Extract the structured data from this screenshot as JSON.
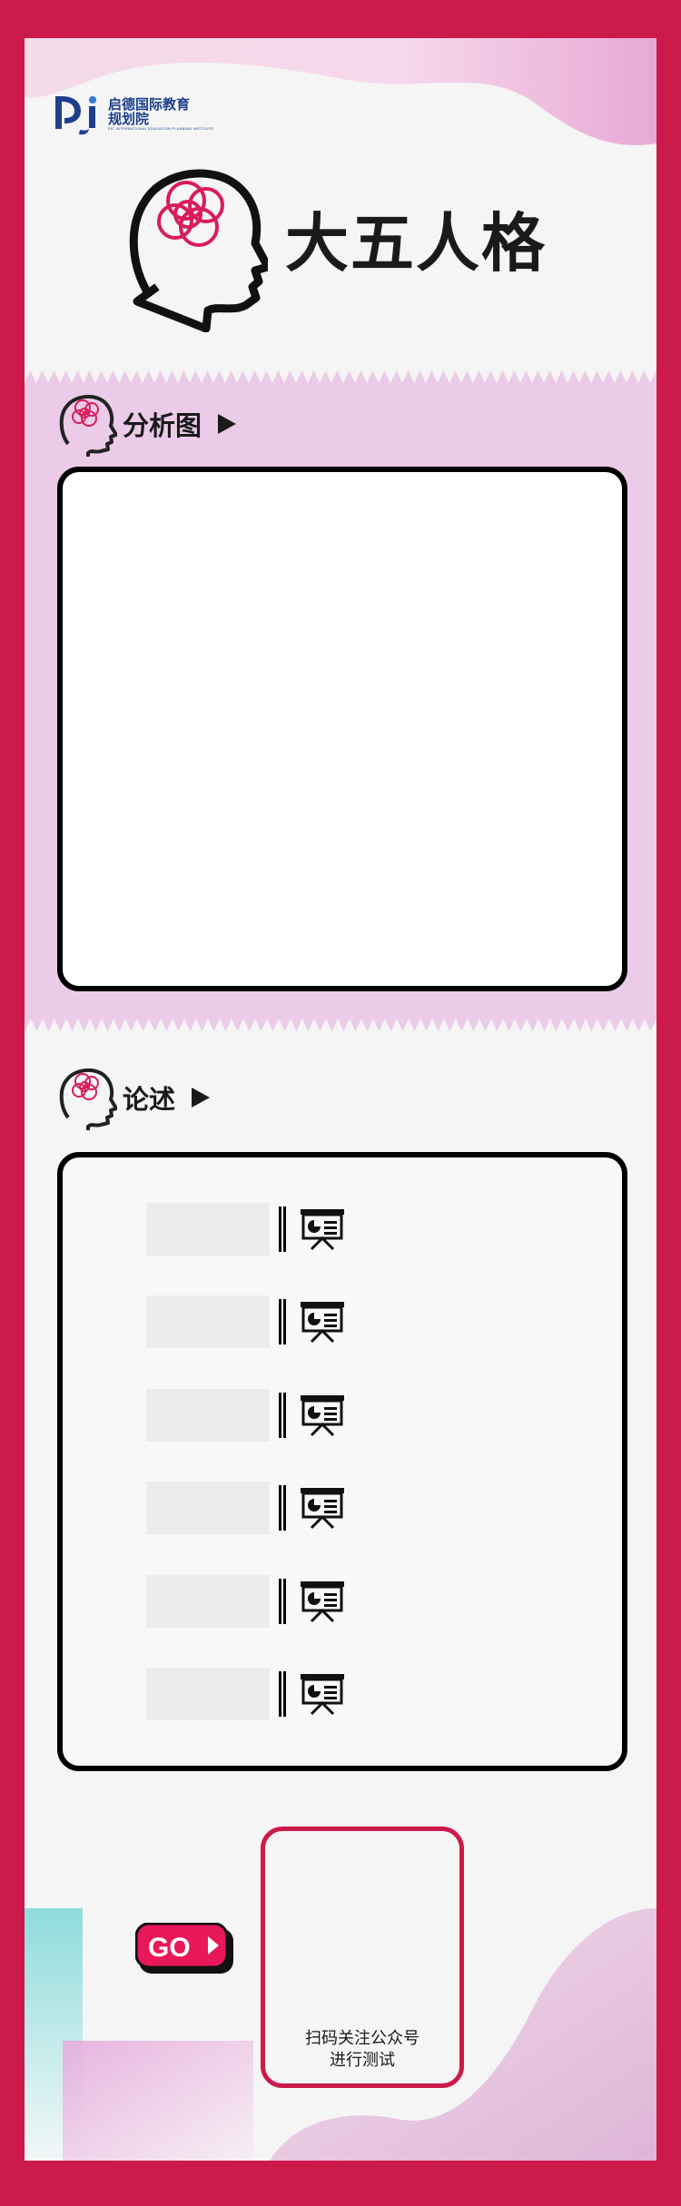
{
  "logo": {
    "name_cn_line1": "启德国际教育",
    "name_cn_line2": "规划院",
    "name_en": "EIC INTERNATIONAL EDUCATION PLANNING INSTITUTE"
  },
  "header": {
    "title": "大五人格"
  },
  "analysis": {
    "title": "分析图"
  },
  "essay": {
    "title": "论述",
    "rows": [
      "",
      "",
      "",
      "",
      "",
      ""
    ]
  },
  "qr": {
    "caption_line1": "扫码关注公众号",
    "caption_line2": "进行测试"
  },
  "go": {
    "label": "GO"
  },
  "colors": {
    "frame": "#cc1a4b",
    "background": "#f5f5f5",
    "band": "#ebcbe8",
    "accent": "#d81d5a",
    "teal": "#8fdcdc"
  },
  "icons": [
    "head-brain-icon",
    "play-arrow-icon",
    "presentation-board-icon",
    "go-arrow-icon"
  ]
}
